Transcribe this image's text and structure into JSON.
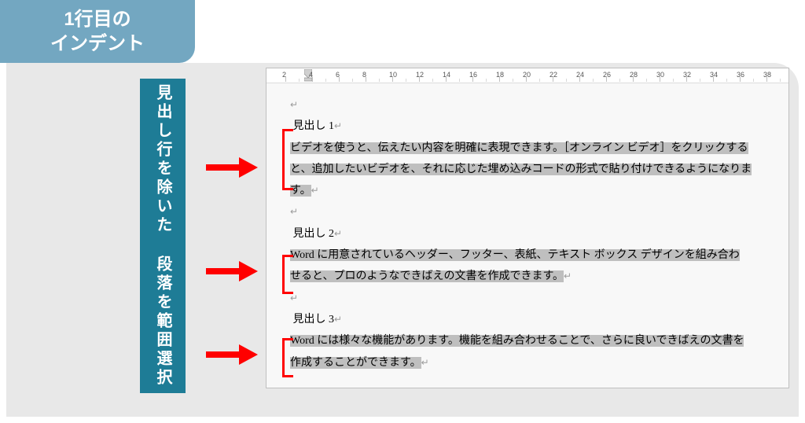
{
  "tab": {
    "line1": "1行目の",
    "line2": "インデント"
  },
  "callout": {
    "line1": "見出し行を除いた",
    "line2": "段落を範囲選択"
  },
  "ruler": {
    "labels": [
      2,
      4,
      6,
      8,
      10,
      12,
      14,
      16,
      18,
      20,
      22,
      24,
      26,
      28,
      30,
      32,
      34,
      36,
      38
    ]
  },
  "doc": {
    "sections": [
      {
        "heading": "見出し 1",
        "body": [
          "ビデオを使うと、伝えたい内容を明確に表現できます。［オンライン ビデオ］をクリックする",
          "と、追加したいビデオを、それに応じた埋め込みコードの形式で貼り付けできるようになりま",
          "す。"
        ]
      },
      {
        "heading": "見出し 2",
        "body": [
          "Word に用意されているヘッダー、フッター、表紙、テキスト ボックス デザインを組み合わ",
          "せると、プロのようなできばえの文書を作成できます。"
        ]
      },
      {
        "heading": "見出し 3",
        "body": [
          "Word には様々な機能があります。機能を組み合わせることで、さらに良いできばえの文書を",
          "作成することができます。"
        ]
      }
    ]
  }
}
